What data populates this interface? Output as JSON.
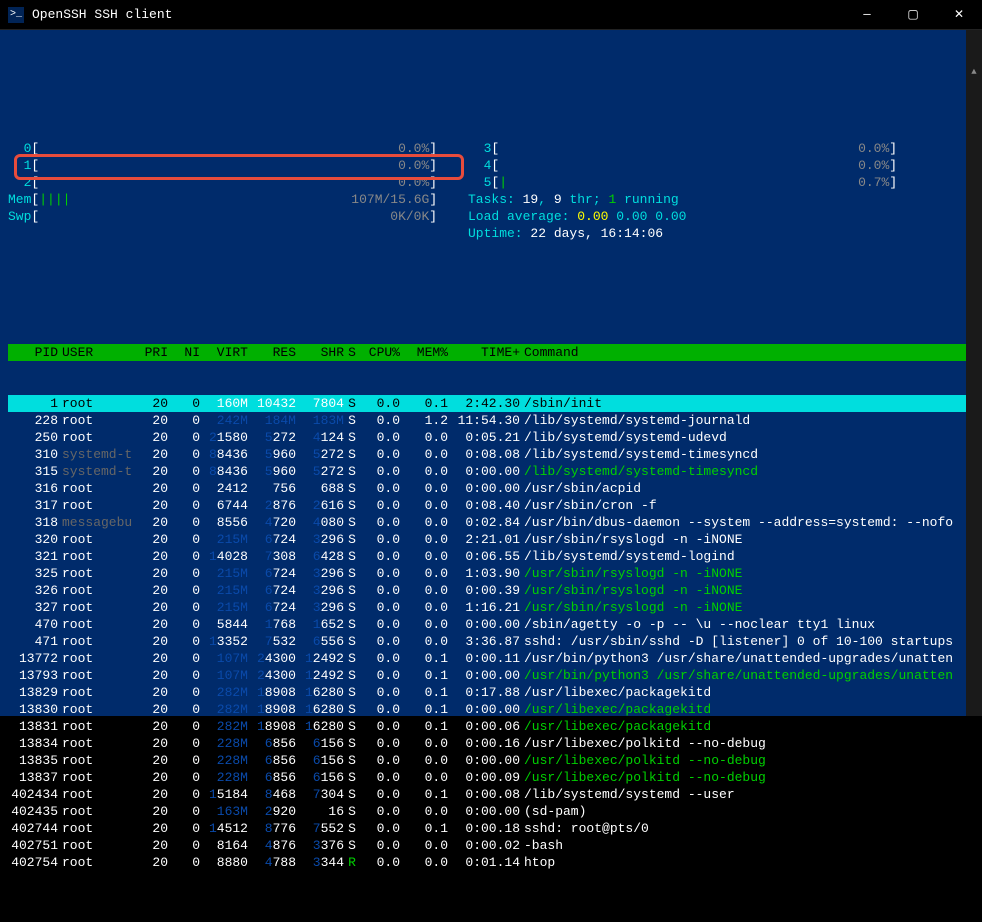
{
  "window": {
    "title": "OpenSSH SSH client"
  },
  "cpus_left": [
    {
      "id": "0",
      "bar": "",
      "pct": "0.0%"
    },
    {
      "id": "1",
      "bar": "",
      "pct": "0.0%"
    },
    {
      "id": "2",
      "bar": "",
      "pct": "0.0%"
    }
  ],
  "cpus_right": [
    {
      "id": "3",
      "bar": "",
      "pct": "0.0%"
    },
    {
      "id": "4",
      "bar": "",
      "pct": "0.0%"
    },
    {
      "id": "5",
      "bar": "|",
      "pct": "0.7%"
    }
  ],
  "mem": {
    "label": "Mem",
    "bar": "||||",
    "used": "107M/15.6G"
  },
  "swp": {
    "label": "Swp",
    "bar": "",
    "used": "0K/0K"
  },
  "stats": {
    "tasks_label": "Tasks:",
    "tasks": "19",
    "thr": "9",
    "thr_label": "thr;",
    "running": "1",
    "running_label": "running",
    "loadavg_label": "Load average:",
    "la1": "0.00",
    "la2": "0.00",
    "la3": "0.00",
    "uptime_label": "Uptime:",
    "uptime": "22 days, 16:14:06"
  },
  "headers": {
    "pid": "PID",
    "user": "USER",
    "pri": "PRI",
    "ni": "NI",
    "virt": "VIRT",
    "res": "RES",
    "shr": "SHR",
    "s": "S",
    "cpu": "CPU%",
    "mem": "MEM%",
    "time": "TIME+",
    "cmd": "Command"
  },
  "processes": [
    {
      "selected": true,
      "pid": "1",
      "user": "root",
      "pri": "20",
      "ni": "0",
      "virt_lead": "",
      "virt": "160M",
      "res_lead": "",
      "res": "10432",
      "shr_lead": "",
      "shr": "7804",
      "s": "S",
      "cpu": "0.0",
      "mem": "0.1",
      "time": "2:42.30",
      "cmd": "/sbin/init"
    },
    {
      "pid": "228",
      "user": "root",
      "pri": "20",
      "ni": "0",
      "virt_lead": "",
      "virt": "242M",
      "virt_dim": true,
      "res_lead": "",
      "res": "184M",
      "res_dim": true,
      "shr_lead": "",
      "shr": "183M",
      "shr_dim": true,
      "s": "S",
      "cpu": "0.0",
      "mem": "1.2",
      "time": "11:54.30",
      "cmd": "/lib/systemd/systemd-journald"
    },
    {
      "pid": "250",
      "user": "root",
      "pri": "20",
      "ni": "0",
      "virt_lead": "2",
      "virt": "1580",
      "res_lead": "5",
      "res": "272",
      "shr_lead": "4",
      "shr": "124",
      "s": "S",
      "cpu": "0.0",
      "mem": "0.0",
      "time": "0:05.21",
      "cmd": "/lib/systemd/systemd-udevd"
    },
    {
      "pid": "310",
      "user": "systemd-t",
      "user_shadow": true,
      "pri": "20",
      "ni": "0",
      "virt_lead": "8",
      "virt": "8436",
      "res_lead": "5",
      "res": "960",
      "shr_lead": "5",
      "shr": "272",
      "s": "S",
      "cpu": "0.0",
      "mem": "0.0",
      "time": "0:08.08",
      "cmd": "/lib/systemd/systemd-timesyncd"
    },
    {
      "pid": "315",
      "user": "systemd-t",
      "user_shadow": true,
      "pri": "20",
      "ni": "0",
      "virt_lead": "8",
      "virt": "8436",
      "res_lead": "5",
      "res": "960",
      "shr_lead": "5",
      "shr": "272",
      "s": "S",
      "cpu": "0.0",
      "mem": "0.0",
      "time": "0:00.00",
      "cmd": "/lib/systemd/systemd-timesyncd",
      "thread": true
    },
    {
      "pid": "316",
      "user": "root",
      "pri": "20",
      "ni": "0",
      "virt_lead": "",
      "virt": "2412",
      "res_lead": "",
      "res": "756",
      "shr_lead": "",
      "shr": "688",
      "s": "S",
      "cpu": "0.0",
      "mem": "0.0",
      "time": "0:00.00",
      "cmd": "/usr/sbin/acpid"
    },
    {
      "pid": "317",
      "user": "root",
      "pri": "20",
      "ni": "0",
      "virt_lead": "",
      "virt": "6744",
      "res_lead": "2",
      "res": "876",
      "shr_lead": "2",
      "shr": "616",
      "s": "S",
      "cpu": "0.0",
      "mem": "0.0",
      "time": "0:08.40",
      "cmd": "/usr/sbin/cron -f"
    },
    {
      "pid": "318",
      "user": "messagebu",
      "user_shadow": true,
      "pri": "20",
      "ni": "0",
      "virt_lead": "",
      "virt": "8556",
      "res_lead": "4",
      "res": "720",
      "shr_lead": "4",
      "shr": "080",
      "s": "S",
      "cpu": "0.0",
      "mem": "0.0",
      "time": "0:02.84",
      "cmd": "/usr/bin/dbus-daemon --system --address=systemd: --nofo"
    },
    {
      "pid": "320",
      "user": "root",
      "pri": "20",
      "ni": "0",
      "virt_lead": "",
      "virt": "215M",
      "virt_dim": true,
      "res_lead": "6",
      "res": "724",
      "shr_lead": "3",
      "shr": "296",
      "s": "S",
      "cpu": "0.0",
      "mem": "0.0",
      "time": "2:21.01",
      "cmd": "/usr/sbin/rsyslogd -n -iNONE"
    },
    {
      "pid": "321",
      "user": "root",
      "pri": "20",
      "ni": "0",
      "virt_lead": "1",
      "virt": "4028",
      "res_lead": "7",
      "res": "308",
      "shr_lead": "6",
      "shr": "428",
      "s": "S",
      "cpu": "0.0",
      "mem": "0.0",
      "time": "0:06.55",
      "cmd": "/lib/systemd/systemd-logind"
    },
    {
      "pid": "325",
      "user": "root",
      "pri": "20",
      "ni": "0",
      "virt_lead": "",
      "virt": "215M",
      "virt_dim": true,
      "res_lead": "6",
      "res": "724",
      "shr_lead": "3",
      "shr": "296",
      "s": "S",
      "cpu": "0.0",
      "mem": "0.0",
      "time": "1:03.90",
      "cmd": "/usr/sbin/rsyslogd -n -iNONE",
      "thread": true
    },
    {
      "pid": "326",
      "user": "root",
      "pri": "20",
      "ni": "0",
      "virt_lead": "",
      "virt": "215M",
      "virt_dim": true,
      "res_lead": "6",
      "res": "724",
      "shr_lead": "3",
      "shr": "296",
      "s": "S",
      "cpu": "0.0",
      "mem": "0.0",
      "time": "0:00.39",
      "cmd": "/usr/sbin/rsyslogd -n -iNONE",
      "thread": true
    },
    {
      "pid": "327",
      "user": "root",
      "pri": "20",
      "ni": "0",
      "virt_lead": "",
      "virt": "215M",
      "virt_dim": true,
      "res_lead": "6",
      "res": "724",
      "shr_lead": "3",
      "shr": "296",
      "s": "S",
      "cpu": "0.0",
      "mem": "0.0",
      "time": "1:16.21",
      "cmd": "/usr/sbin/rsyslogd -n -iNONE",
      "thread": true
    },
    {
      "pid": "470",
      "user": "root",
      "pri": "20",
      "ni": "0",
      "virt_lead": "",
      "virt": "5844",
      "res_lead": "1",
      "res": "768",
      "shr_lead": "1",
      "shr": "652",
      "s": "S",
      "cpu": "0.0",
      "mem": "0.0",
      "time": "0:00.00",
      "cmd": "/sbin/agetty -o -p -- \\u --noclear tty1 linux"
    },
    {
      "pid": "471",
      "user": "root",
      "pri": "20",
      "ni": "0",
      "virt_lead": "1",
      "virt": "3352",
      "res_lead": "7",
      "res": "532",
      "shr_lead": "6",
      "shr": "556",
      "s": "S",
      "cpu": "0.0",
      "mem": "0.0",
      "time": "3:36.87",
      "cmd": "sshd: /usr/sbin/sshd -D [listener] 0 of 10-100 startups"
    },
    {
      "pid": "13772",
      "user": "root",
      "pri": "20",
      "ni": "0",
      "virt_lead": "",
      "virt": "107M",
      "virt_dim": true,
      "res_lead": "2",
      "res": "4300",
      "shr_lead": "1",
      "shr": "2492",
      "s": "S",
      "cpu": "0.0",
      "mem": "0.1",
      "time": "0:00.11",
      "cmd": "/usr/bin/python3 /usr/share/unattended-upgrades/unatten"
    },
    {
      "pid": "13793",
      "user": "root",
      "pri": "20",
      "ni": "0",
      "virt_lead": "",
      "virt": "107M",
      "virt_dim": true,
      "res_lead": "2",
      "res": "4300",
      "shr_lead": "1",
      "shr": "2492",
      "s": "S",
      "cpu": "0.0",
      "mem": "0.1",
      "time": "0:00.00",
      "cmd": "/usr/bin/python3 /usr/share/unattended-upgrades/unatten",
      "thread": true
    },
    {
      "pid": "13829",
      "user": "root",
      "pri": "20",
      "ni": "0",
      "virt_lead": "",
      "virt": "282M",
      "virt_dim": true,
      "res_lead": "1",
      "res": "8908",
      "shr_lead": "1",
      "shr": "6280",
      "s": "S",
      "cpu": "0.0",
      "mem": "0.1",
      "time": "0:17.88",
      "cmd": "/usr/libexec/packagekitd"
    },
    {
      "pid": "13830",
      "user": "root",
      "pri": "20",
      "ni": "0",
      "virt_lead": "",
      "virt": "282M",
      "virt_dim": true,
      "res_lead": "1",
      "res": "8908",
      "shr_lead": "1",
      "shr": "6280",
      "s": "S",
      "cpu": "0.0",
      "mem": "0.1",
      "time": "0:00.00",
      "cmd": "/usr/libexec/packagekitd",
      "thread": true
    },
    {
      "pid": "13831",
      "user": "root",
      "pri": "20",
      "ni": "0",
      "virt_lead": "",
      "virt": "282M",
      "virt_dim": true,
      "res_lead": "1",
      "res": "8908",
      "shr_lead": "1",
      "shr": "6280",
      "s": "S",
      "cpu": "0.0",
      "mem": "0.1",
      "time": "0:00.06",
      "cmd": "/usr/libexec/packagekitd",
      "thread": true
    },
    {
      "pid": "13834",
      "user": "root",
      "pri": "20",
      "ni": "0",
      "virt_lead": "",
      "virt": "228M",
      "virt_dim": true,
      "res_lead": "6",
      "res": "856",
      "shr_lead": "6",
      "shr": "156",
      "s": "S",
      "cpu": "0.0",
      "mem": "0.0",
      "time": "0:00.16",
      "cmd": "/usr/libexec/polkitd --no-debug"
    },
    {
      "pid": "13835",
      "user": "root",
      "pri": "20",
      "ni": "0",
      "virt_lead": "",
      "virt": "228M",
      "virt_dim": true,
      "res_lead": "6",
      "res": "856",
      "shr_lead": "6",
      "shr": "156",
      "s": "S",
      "cpu": "0.0",
      "mem": "0.0",
      "time": "0:00.00",
      "cmd": "/usr/libexec/polkitd --no-debug",
      "thread": true
    },
    {
      "pid": "13837",
      "user": "root",
      "pri": "20",
      "ni": "0",
      "virt_lead": "",
      "virt": "228M",
      "virt_dim": true,
      "res_lead": "6",
      "res": "856",
      "shr_lead": "6",
      "shr": "156",
      "s": "S",
      "cpu": "0.0",
      "mem": "0.0",
      "time": "0:00.09",
      "cmd": "/usr/libexec/polkitd --no-debug",
      "thread": true
    },
    {
      "pid": "402434",
      "user": "root",
      "pri": "20",
      "ni": "0",
      "virt_lead": "1",
      "virt": "5184",
      "res_lead": "8",
      "res": "468",
      "shr_lead": "7",
      "shr": "304",
      "s": "S",
      "cpu": "0.0",
      "mem": "0.1",
      "time": "0:00.08",
      "cmd": "/lib/systemd/systemd --user"
    },
    {
      "pid": "402435",
      "user": "root",
      "pri": "20",
      "ni": "0",
      "virt_lead": "",
      "virt": "163M",
      "virt_dim": true,
      "res_lead": "2",
      "res": "920",
      "shr_lead": "",
      "shr": "16",
      "s": "S",
      "cpu": "0.0",
      "mem": "0.0",
      "time": "0:00.00",
      "cmd": "(sd-pam)"
    },
    {
      "pid": "402744",
      "user": "root",
      "pri": "20",
      "ni": "0",
      "virt_lead": "1",
      "virt": "4512",
      "res_lead": "8",
      "res": "776",
      "shr_lead": "7",
      "shr": "552",
      "s": "S",
      "cpu": "0.0",
      "mem": "0.1",
      "time": "0:00.18",
      "cmd": "sshd: root@pts/0"
    },
    {
      "pid": "402751",
      "user": "root",
      "pri": "20",
      "ni": "0",
      "virt_lead": "",
      "virt": "8164",
      "res_lead": "4",
      "res": "876",
      "shr_lead": "3",
      "shr": "376",
      "s": "S",
      "cpu": "0.0",
      "mem": "0.0",
      "time": "0:00.02",
      "cmd": "-bash"
    },
    {
      "pid": "402754",
      "user": "root",
      "pri": "20",
      "ni": "0",
      "virt_lead": "",
      "virt": "8880",
      "res_lead": "4",
      "res": "788",
      "shr_lead": "3",
      "shr": "344",
      "s": "R",
      "s_green": true,
      "cpu": "0.0",
      "mem": "0.0",
      "time": "0:01.14",
      "cmd": "htop"
    }
  ]
}
